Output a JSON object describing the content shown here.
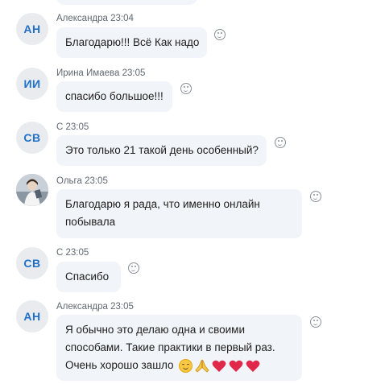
{
  "messages": [
    {
      "initials": "АН",
      "author": "Александра",
      "time": "23:04",
      "lines": [
        "Благодарю!!! Всё Как надо"
      ]
    },
    {
      "initials": "ИИ",
      "author": "Ирина Имаева",
      "time": "23:05",
      "lines": [
        "спасибо большое!!!"
      ]
    },
    {
      "initials": "СВ",
      "author": "С",
      "time": "23:05",
      "lines": [
        "Это только 21 такой день особенный?"
      ]
    },
    {
      "initials": "",
      "author": "Ольга",
      "time": "23:05",
      "lines": [
        "Благодарю я рада, что именно онлайн",
        "побывала"
      ]
    },
    {
      "initials": "СВ",
      "author": "С",
      "time": "23:05",
      "lines": [
        "Спасибо"
      ]
    },
    {
      "initials": "АН",
      "author": "Александра",
      "time": "23:05",
      "lines": [
        "Я обычно это делаю одна и своими",
        "способами. Такие практики в первый раз.",
        "Очень хорошо зашло"
      ],
      "emojis": [
        "smiling-face",
        "folded-hands",
        "heart",
        "heart",
        "heart"
      ]
    }
  ],
  "colors": {
    "bubble": "#f1f4f8",
    "initials": "#2071c7",
    "avatar_bg": "#e9ebef",
    "heart": "#e0284a"
  }
}
